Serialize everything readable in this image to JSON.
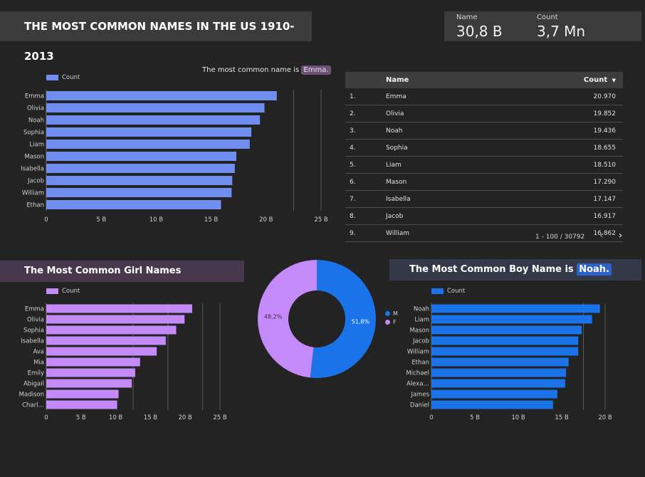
{
  "header": {
    "title": "THE MOST COMMON NAMES IN THE US 1910-2013"
  },
  "kpis": [
    {
      "label": "Name",
      "value": "30,8 B"
    },
    {
      "label": "Count",
      "value": "3,7 Mn"
    }
  ],
  "note": {
    "prefix": "The most common name is ",
    "name": "Emma."
  },
  "girl_section": {
    "title": "The Most Common Girl Names"
  },
  "boy_section": {
    "prefix": "The Most Common Boy Name is ",
    "name": "Noah."
  },
  "table": {
    "headers": {
      "name": "Name",
      "count": "Count"
    },
    "sort_icon": "sort-desc-icon",
    "rows": [
      {
        "idx": "1.",
        "name": "Emma",
        "count": "20.970"
      },
      {
        "idx": "2.",
        "name": "Olivia",
        "count": "19.852"
      },
      {
        "idx": "3.",
        "name": "Noah",
        "count": "19.436"
      },
      {
        "idx": "4.",
        "name": "Sophia",
        "count": "18.655"
      },
      {
        "idx": "5.",
        "name": "Liam",
        "count": "18.510"
      },
      {
        "idx": "6.",
        "name": "Mason",
        "count": "17.290"
      },
      {
        "idx": "7.",
        "name": "Isabella",
        "count": "17.147"
      },
      {
        "idx": "8.",
        "name": "Jacob",
        "count": "16.917"
      },
      {
        "idx": "9.",
        "name": "William",
        "count": "16.862"
      }
    ],
    "pagination": "1 - 100 / 30792"
  },
  "colors": {
    "all": "#6f8ef0",
    "girls": "#c58af9",
    "boys": "#1a73e8",
    "pie_m": "#1a73e8",
    "pie_f": "#c58af9"
  },
  "chart_data": [
    {
      "id": "all",
      "type": "bar",
      "orientation": "horizontal",
      "legend": "Count",
      "categories": [
        "Emma",
        "Olivia",
        "Noah",
        "Sophia",
        "Liam",
        "Mason",
        "Isabella",
        "Jacob",
        "William",
        "Ethan"
      ],
      "values": [
        20.97,
        19.85,
        19.44,
        18.66,
        18.51,
        17.29,
        17.15,
        16.92,
        16.86,
        15.9
      ],
      "xlim": [
        0,
        25
      ],
      "ticks": [
        "0",
        "5 B",
        "10 B",
        "15 B",
        "20 B",
        "25 B"
      ],
      "gridlines": [
        22.5,
        25
      ]
    },
    {
      "id": "girls",
      "type": "bar",
      "orientation": "horizontal",
      "legend": "Count",
      "categories": [
        "Emma",
        "Olivia",
        "Sophia",
        "Isabella",
        "Ava",
        "Mia",
        "Emily",
        "Abigail",
        "Madison",
        "Charl…"
      ],
      "values": [
        21.0,
        19.9,
        18.7,
        17.2,
        15.9,
        13.5,
        12.8,
        12.3,
        10.4,
        10.2
      ],
      "xlim": [
        0,
        25
      ],
      "ticks": [
        "0",
        "5 B",
        "10 B",
        "15 B",
        "20 B",
        "25 B"
      ],
      "gridlines": [
        12.5,
        17.5,
        22.5,
        25
      ]
    },
    {
      "id": "gender",
      "type": "pie",
      "donut": true,
      "labels": [
        "M",
        "F"
      ],
      "values": [
        51.8,
        48.2
      ],
      "value_labels": [
        "51,8%",
        "48,2%"
      ]
    },
    {
      "id": "boys",
      "type": "bar",
      "orientation": "horizontal",
      "legend": "Count",
      "categories": [
        "Noah",
        "Liam",
        "Mason",
        "Jacob",
        "William",
        "Ethan",
        "Michael",
        "Alexa…",
        "James",
        "Daniel"
      ],
      "values": [
        19.4,
        18.5,
        17.3,
        16.9,
        16.9,
        15.8,
        15.5,
        15.4,
        14.5,
        14.0
      ],
      "xlim": [
        0,
        20
      ],
      "ticks": [
        "0",
        "5 B",
        "10 B",
        "15 B",
        "20 B"
      ],
      "gridlines": [
        17.5,
        20
      ]
    }
  ]
}
